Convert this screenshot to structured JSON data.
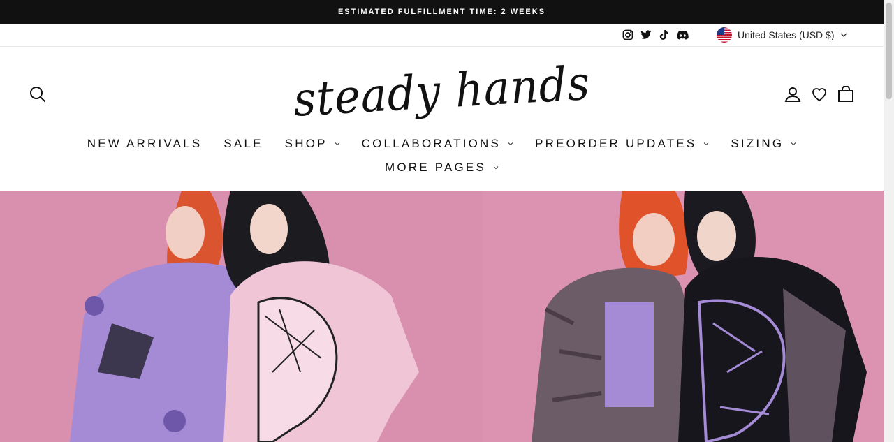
{
  "announcement": "ESTIMATED FULFILLMENT TIME: 2 WEEKS",
  "social": [
    "instagram-icon",
    "twitter-icon",
    "tiktok-icon",
    "discord-icon"
  ],
  "currency": {
    "label": "United States (USD $)",
    "flag": "us-flag-icon"
  },
  "header": {
    "logo_text": "steady hands",
    "icons": [
      "search-icon",
      "account-icon",
      "wishlist-heart-icon",
      "cart-bag-icon"
    ]
  },
  "nav": {
    "row1": [
      {
        "label": "NEW ARRIVALS",
        "has_dropdown": false
      },
      {
        "label": "SALE",
        "has_dropdown": false
      },
      {
        "label": "SHOP",
        "has_dropdown": true
      },
      {
        "label": "COLLABORATIONS",
        "has_dropdown": true
      },
      {
        "label": "PREORDER UPDATES",
        "has_dropdown": true
      },
      {
        "label": "SIZING",
        "has_dropdown": true
      }
    ],
    "row2": [
      {
        "label": "MORE PAGES",
        "has_dropdown": true
      }
    ]
  },
  "colors": {
    "announcement_bg": "#111111",
    "hero_bg": "#d98fae",
    "lavender": "#a58ad6"
  }
}
